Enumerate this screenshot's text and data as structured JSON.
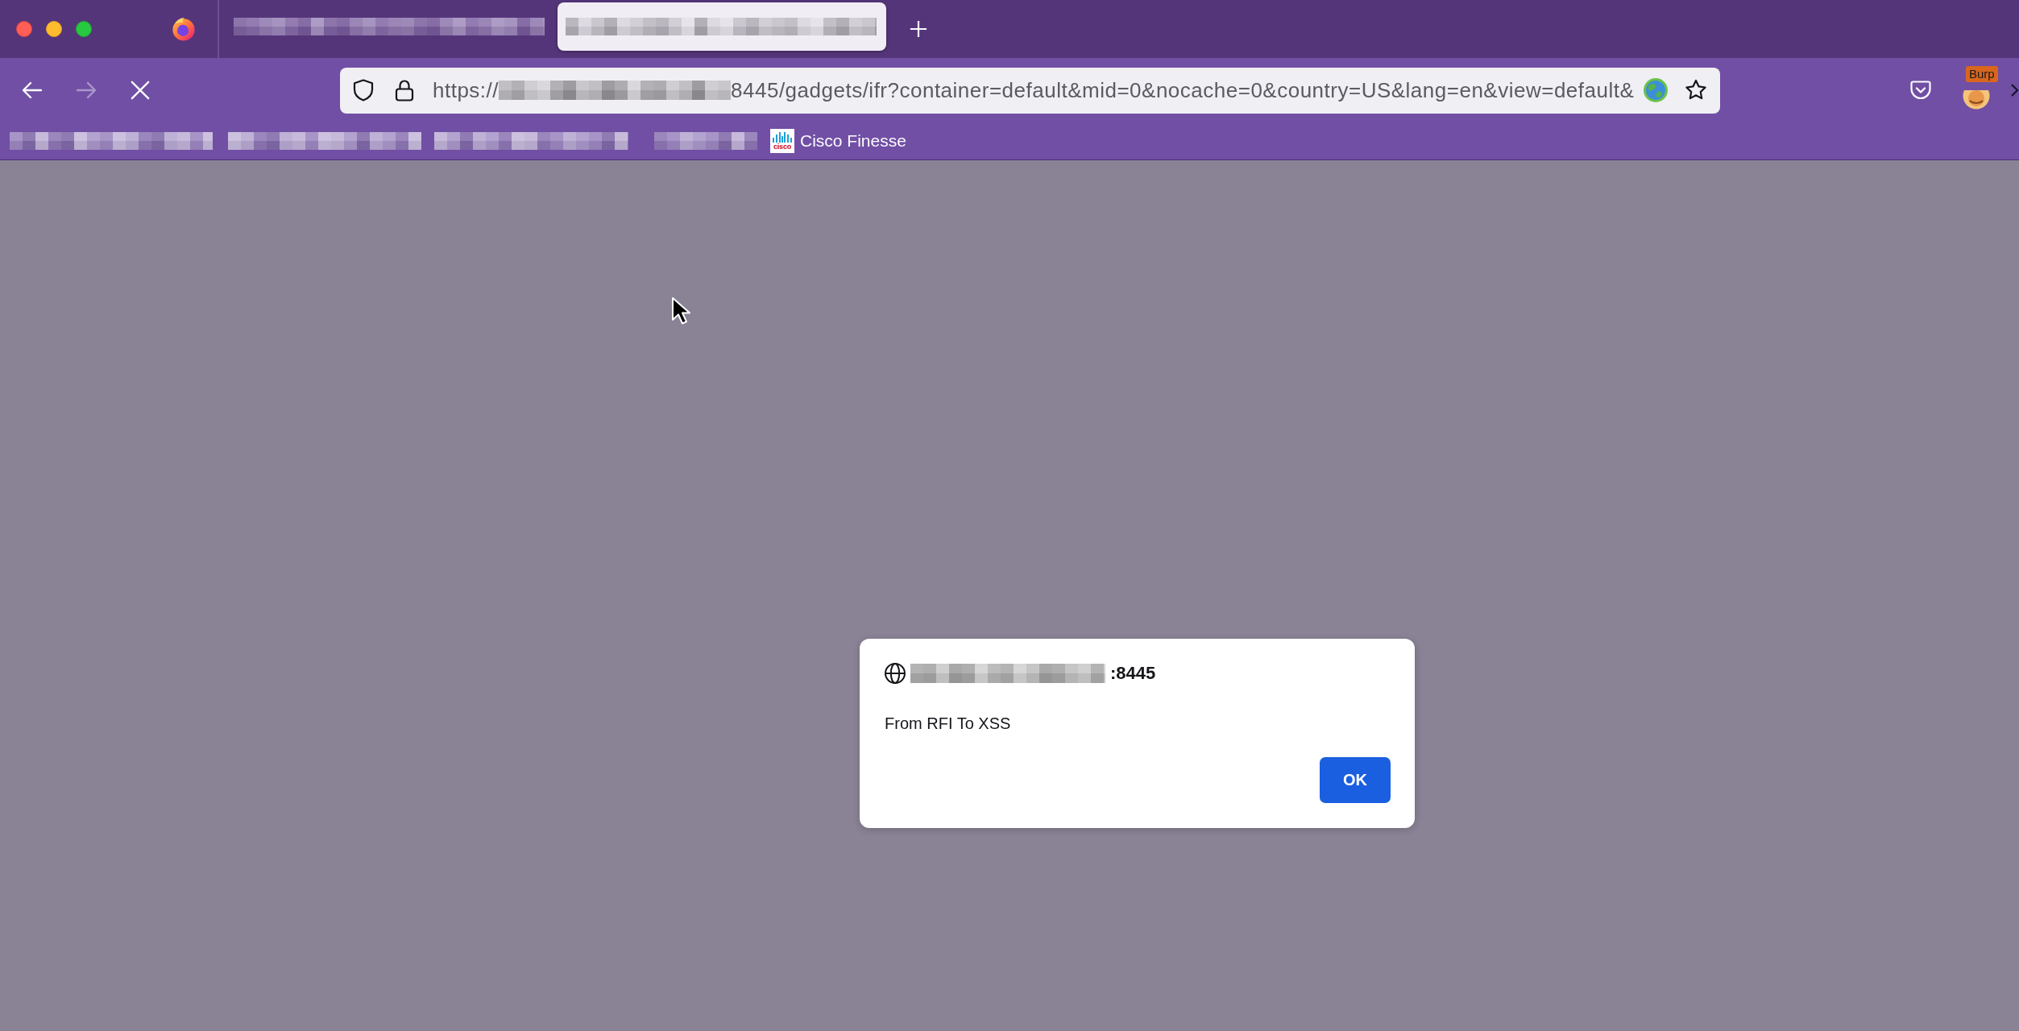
{
  "tabs": [
    {
      "selected": false
    },
    {
      "selected": true
    }
  ],
  "navigation": [
    {
      "kind": "back",
      "disabled": false
    },
    {
      "kind": "forward",
      "disabled": true
    },
    {
      "kind": "stop",
      "disabled": false
    }
  ],
  "address_bar": {
    "url": [
      {
        "kind": "text",
        "text": "https://"
      },
      {
        "kind": "redacted"
      },
      {
        "kind": "text",
        "text": "8445/gadgets/ifr?container=default&mid=0&nocache=0&country=US&lang=en&view=default&"
      }
    ]
  },
  "extensions": [
    {
      "badge": "Burp"
    }
  ],
  "bookmarks": [
    {
      "kind": "redacted"
    },
    {
      "kind": "redacted"
    },
    {
      "kind": "redacted"
    },
    {
      "kind": "redacted"
    },
    {
      "kind": "site",
      "icon_text": "cisco",
      "label": "Cisco Finesse"
    }
  ],
  "dialog": {
    "origin": [
      {
        "kind": "redacted"
      },
      {
        "kind": "text",
        "text": ":8445"
      }
    ],
    "message": "From RFI To XSS",
    "buttons": [
      "OK"
    ]
  }
}
